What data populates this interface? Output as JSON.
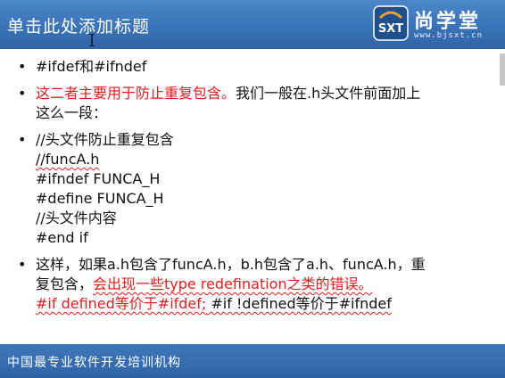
{
  "header": {
    "title": "单击此处添加标题",
    "logo_text": "尚学堂",
    "logo_url": "www.bjsxt.cn",
    "logo_mark": "SXT"
  },
  "bullets": [
    {
      "lines": [
        {
          "black": "#ifdef和#ifndef"
        }
      ]
    },
    {
      "lines": [
        {
          "red": "这二者主要用于防止重复包含。",
          "black": "我们一般在.h头文件前面加上"
        },
        {
          "black": "这么一段："
        }
      ]
    },
    {
      "lines": [
        {
          "black": "//头文件防止重复包含"
        },
        {
          "black": "//funcA.h"
        },
        {
          "black": "#ifndef FUNCA_H"
        },
        {
          "black": "#define FUNCA_H"
        },
        {
          "black": "//头文件内容"
        },
        {
          "black": "#end if"
        }
      ]
    },
    {
      "lines": [
        {
          "black": "这样，如果a.h包含了funcA.h，b.h包含了a.h、funcA.h，重"
        },
        {
          "black": "复包含，",
          "red": "会出现一些type redefination之类的错误。"
        },
        {
          "red": "#if defined等价于#ifdef;",
          "black": " #if !defined等价于#ifndef"
        }
      ]
    }
  ],
  "footer": {
    "text": "中国最专业软件开发培训机构"
  },
  "colors": {
    "header": "#3a73b8",
    "accent_red": "#e31d1d",
    "text": "#111111"
  },
  "icons": {
    "logo": "sxt-logo-icon",
    "cursor": "text-cursor-icon"
  }
}
